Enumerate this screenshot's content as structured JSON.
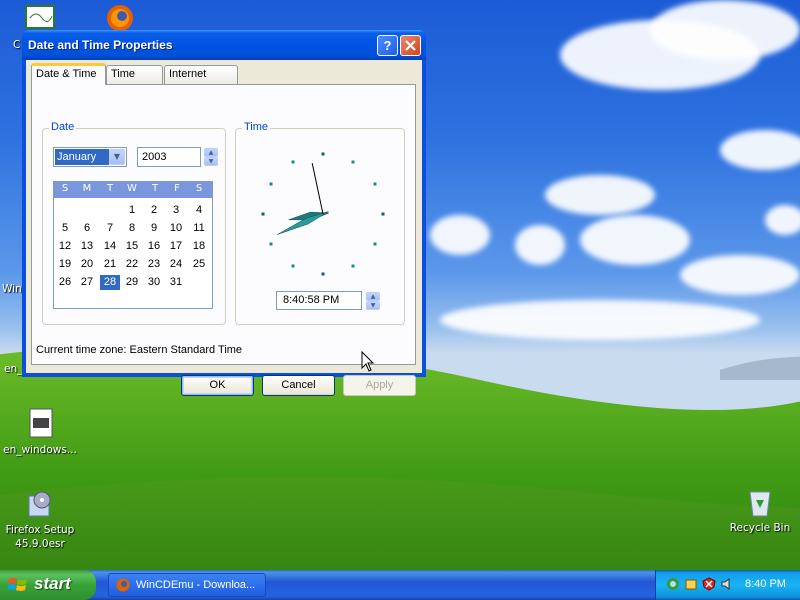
{
  "desktop": {
    "icons": [
      {
        "label": "C"
      },
      {
        "label": "Win"
      },
      {
        "label": "en_"
      },
      {
        "label": "en_windows..."
      },
      {
        "label": "Firefox Setup 45.9.0esr"
      },
      {
        "label": "Recycle Bin"
      }
    ]
  },
  "window": {
    "title": "Date and Time Properties",
    "help_label": "?",
    "tabs": [
      {
        "label": "Date & Time",
        "active": true
      },
      {
        "label": "Time Zone",
        "active": false
      },
      {
        "label": "Internet Time",
        "active": false
      }
    ],
    "date_group": {
      "label": "Date",
      "month": "January",
      "year": "2003",
      "days_of_week": [
        "S",
        "M",
        "T",
        "W",
        "T",
        "F",
        "S"
      ],
      "weeks": [
        [
          "",
          "",
          "",
          "1",
          "2",
          "3",
          "4"
        ],
        [
          "5",
          "6",
          "7",
          "8",
          "9",
          "10",
          "11"
        ],
        [
          "12",
          "13",
          "14",
          "15",
          "16",
          "17",
          "18"
        ],
        [
          "19",
          "20",
          "21",
          "22",
          "23",
          "24",
          "25"
        ],
        [
          "26",
          "27",
          "28",
          "29",
          "30",
          "31",
          ""
        ]
      ],
      "selected_day": "28"
    },
    "time_group": {
      "label": "Time",
      "time": "8:40:58 PM",
      "hour": 8,
      "minute": 40,
      "second": 58
    },
    "timezone_text": "Current time zone:  Eastern Standard Time",
    "buttons": {
      "ok": "OK",
      "cancel": "Cancel",
      "apply": "Apply"
    }
  },
  "taskbar": {
    "start_label": "start",
    "task_label": "WinCDEmu - Downloa...",
    "clock": "8:40 PM"
  },
  "colors": {
    "title_blue": "#0054e3",
    "accent_selection": "#316ac5",
    "start_green": "#37a337",
    "group_label_blue": "#0046d5"
  }
}
